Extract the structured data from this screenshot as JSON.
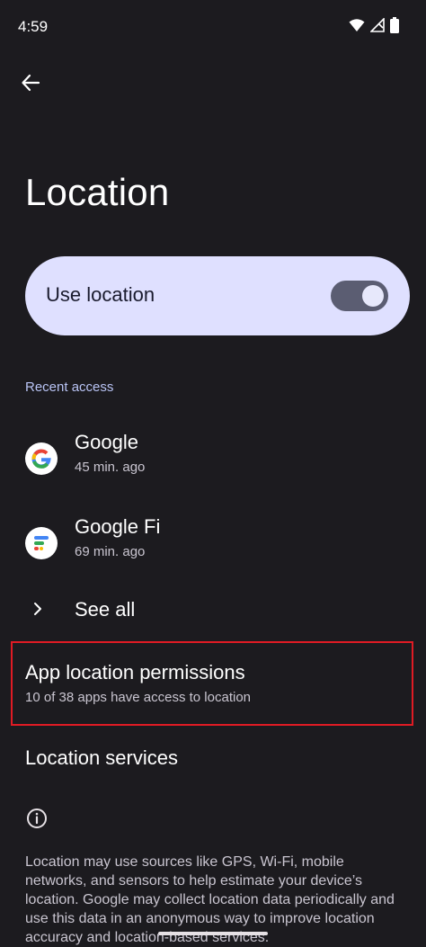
{
  "status_bar": {
    "time": "4:59"
  },
  "header": {
    "title": "Location"
  },
  "master_switch": {
    "label": "Use location",
    "enabled": true
  },
  "recent_access": {
    "header": "Recent access",
    "apps": [
      {
        "name": "Google",
        "time": "45 min. ago",
        "icon": "google-g-icon"
      },
      {
        "name": "Google Fi",
        "time": "69 min. ago",
        "icon": "google-fi-icon"
      }
    ],
    "see_all_label": "See all"
  },
  "app_permissions": {
    "title": "App location permissions",
    "subtitle": "10 of 38 apps have access to location"
  },
  "location_services": {
    "title": "Location services"
  },
  "footer": {
    "text": "Location may use sources like GPS, Wi-Fi, mobile networks, and sensors to help estimate your device’s location. Google may collect location data periodically and use this data in an anonymous way to improve location accuracy and location-based services."
  },
  "colors": {
    "background": "#1c1b1f",
    "switch_bg": "#dfe0ff",
    "accent_header": "#b9c4f5",
    "highlight": "#e01b24"
  }
}
